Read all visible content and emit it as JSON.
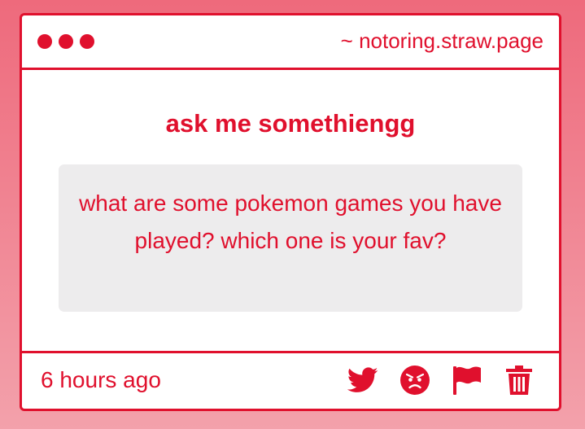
{
  "window": {
    "url": "~ notoring.straw.page"
  },
  "main": {
    "title": "ask me somethiengg",
    "question": "what are some pokemon games you have played? which one is your fav?"
  },
  "footer": {
    "time": "6 hours ago",
    "actions": [
      "twitter-icon",
      "angry-face-icon",
      "flag-icon",
      "trash-icon"
    ]
  },
  "colors": {
    "accent": "#e0102d",
    "box": "#edeced",
    "background_top": "#ee6a7c",
    "background_bottom": "#f3a1ab"
  }
}
